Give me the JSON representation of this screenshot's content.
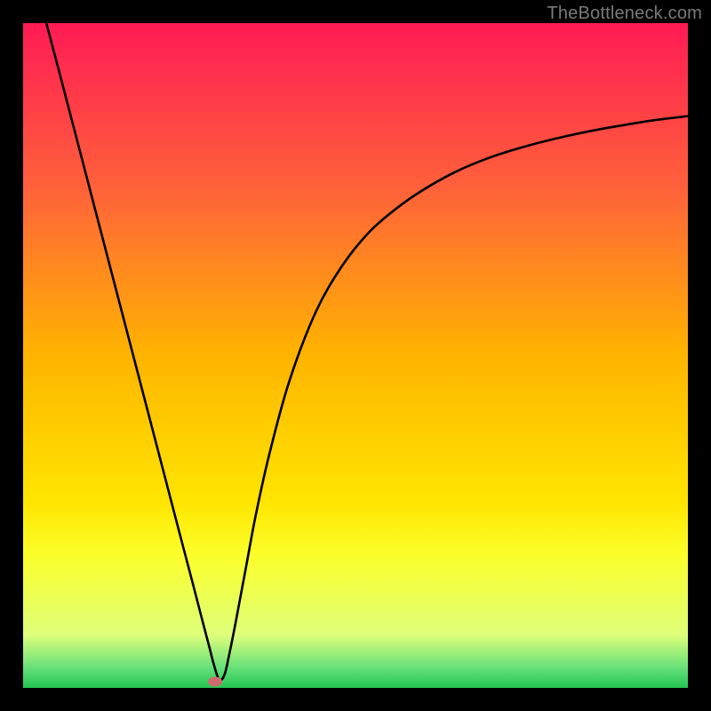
{
  "watermark": "TheBottleneck.com",
  "chart_data": {
    "type": "line",
    "title": "",
    "xlabel": "",
    "ylabel": "",
    "xlim": [
      0,
      100
    ],
    "ylim": [
      0,
      100
    ],
    "grid": false,
    "legend": false,
    "gradient_stops": [
      {
        "offset": 0,
        "color": "#ff1a55"
      },
      {
        "offset": 25,
        "color": "#ff623a"
      },
      {
        "offset": 50,
        "color": "#ffb400"
      },
      {
        "offset": 72,
        "color": "#ffe500"
      },
      {
        "offset": 80,
        "color": "#fbff2a"
      },
      {
        "offset": 92,
        "color": "#dfff7a"
      },
      {
        "offset": 97,
        "color": "#66e07a"
      },
      {
        "offset": 100,
        "color": "#23c552"
      }
    ],
    "series": [
      {
        "name": "bottleneck-curve",
        "x": [
          3.5,
          6,
          9,
          12,
          15,
          18,
          21,
          23.5,
          25.5,
          27,
          28,
          28.7,
          29.5,
          30.3,
          31,
          32,
          33.5,
          35,
          37,
          40,
          44,
          48,
          52,
          56,
          60,
          65,
          70,
          75,
          80,
          85,
          90,
          95,
          100
        ],
        "y": [
          100,
          90.5,
          79.0,
          67.5,
          56.0,
          44.5,
          33.0,
          23.4,
          15.8,
          10.0,
          6.2,
          3.5,
          1.2,
          2.0,
          5.0,
          10.0,
          18.0,
          26.0,
          35.0,
          46.0,
          56.5,
          63.5,
          68.5,
          72.0,
          74.8,
          77.6,
          79.7,
          81.3,
          82.6,
          83.7,
          84.6,
          85.4,
          86.0
        ]
      }
    ],
    "marker": {
      "x": 28.9,
      "y": 0.9,
      "color": "#cf6b6f"
    }
  }
}
